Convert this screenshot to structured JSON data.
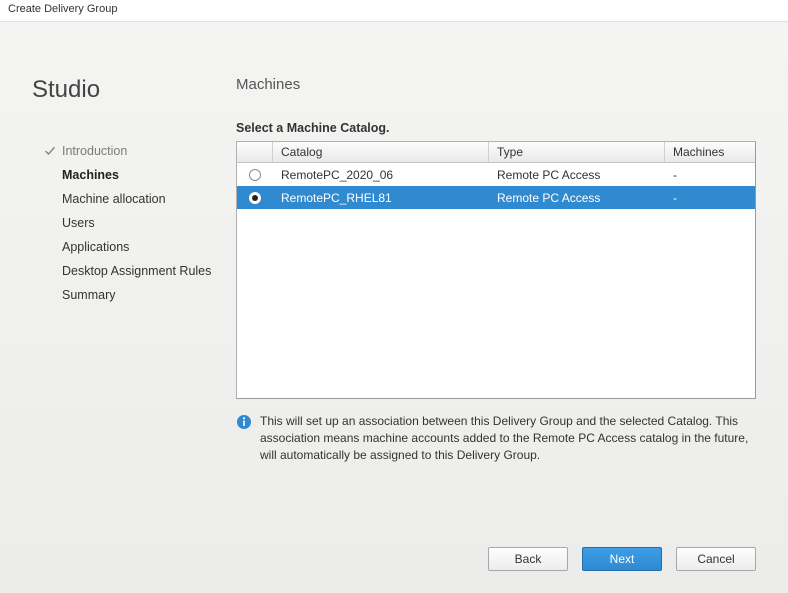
{
  "window": {
    "title": "Create Delivery Group"
  },
  "sidebar": {
    "title": "Studio",
    "items": [
      {
        "label": "Introduction",
        "state": "completed"
      },
      {
        "label": "Machines",
        "state": "active"
      },
      {
        "label": "Machine allocation",
        "state": "pending"
      },
      {
        "label": "Users",
        "state": "pending"
      },
      {
        "label": "Applications",
        "state": "pending"
      },
      {
        "label": "Desktop Assignment Rules",
        "state": "pending"
      },
      {
        "label": "Summary",
        "state": "pending"
      }
    ]
  },
  "main": {
    "heading": "Machines",
    "subheading": "Select a Machine Catalog.",
    "columns": {
      "catalog": "Catalog",
      "type": "Type",
      "machines": "Machines"
    },
    "rows": [
      {
        "catalog": "RemotePC_2020_06",
        "type": "Remote PC Access",
        "machines": "-",
        "selected": false
      },
      {
        "catalog": "RemotePC_RHEL81",
        "type": "Remote PC Access",
        "machines": "-",
        "selected": true
      }
    ],
    "info": "This will set up an association between this Delivery Group and the selected Catalog. This association means machine accounts added to the Remote PC Access catalog in the future, will automatically be assigned to this Delivery Group."
  },
  "buttons": {
    "back": "Back",
    "next": "Next",
    "cancel": "Cancel"
  }
}
